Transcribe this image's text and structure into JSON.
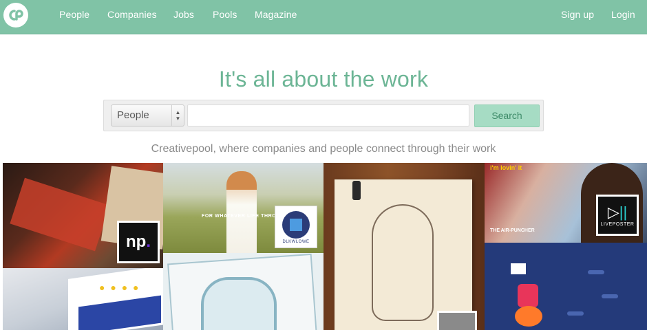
{
  "colors": {
    "nav_background": "#80c3a6",
    "headline": "#6cb595",
    "search_button": "#a6dcc4",
    "tagline": "#8a8a8a"
  },
  "nav": {
    "logo_icon": "creativepool-logo-icon",
    "links": [
      "People",
      "Companies",
      "Jobs",
      "Pools",
      "Magazine"
    ],
    "sign_up": "Sign up",
    "login": "Login"
  },
  "hero": {
    "headline": "It's all about the work",
    "search": {
      "category_selected": "People",
      "query_value": "",
      "button_label": "Search"
    },
    "tagline": "Creativepool, where companies and people connect through their work"
  },
  "gallery": {
    "tiles": [
      {
        "badge_text": "np",
        "badge_dot": "."
      },
      {
        "overlay_text": "FOR WHATEVER LIFE THRO",
        "badge_label": "DLKWLOWE"
      },
      {},
      {},
      {},
      {
        "overlay_brand": "i'm lovin' it",
        "caption": "THE AIR-PUNCHER",
        "badge_label": "LIVEPOSTER"
      },
      {}
    ]
  }
}
